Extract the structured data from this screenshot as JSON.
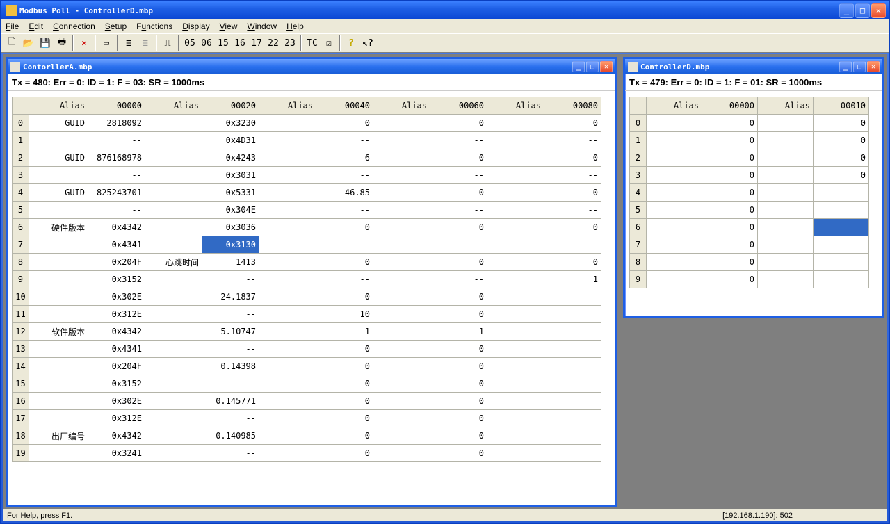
{
  "app": {
    "title": "Modbus Poll - ControllerD.mbp"
  },
  "menu": {
    "file": "File",
    "edit": "Edit",
    "connection": "Connection",
    "setup": "Setup",
    "functions": "Functions",
    "display": "Display",
    "view": "View",
    "window": "Window",
    "help": "Help"
  },
  "toolbar": {
    "codes": [
      "05",
      "06",
      "15",
      "16",
      "17",
      "22",
      "23"
    ],
    "tc": "TC"
  },
  "status": {
    "help": "For Help, press F1.",
    "addr": "[192.168.1.190]: 502"
  },
  "winA": {
    "title": "ContorllerA.mbp",
    "status": "Tx = 480: Err = 0: ID = 1: F = 03: SR = 1000ms",
    "headers": [
      "",
      "Alias",
      "00000",
      "Alias",
      "00020",
      "Alias",
      "00040",
      "Alias",
      "00060",
      "Alias",
      "00080"
    ],
    "selected": {
      "row": 7,
      "col": 4
    },
    "rows": [
      [
        "0",
        "GUID",
        "2818092",
        "",
        "0x3230",
        "",
        "0",
        "",
        "0",
        "",
        "0"
      ],
      [
        "1",
        "",
        "--",
        "",
        "0x4D31",
        "",
        "--",
        "",
        "--",
        "",
        "--"
      ],
      [
        "2",
        "GUID",
        "876168978",
        "",
        "0x4243",
        "",
        "-6",
        "",
        "0",
        "",
        "0"
      ],
      [
        "3",
        "",
        "--",
        "",
        "0x3031",
        "",
        "--",
        "",
        "--",
        "",
        "--"
      ],
      [
        "4",
        "GUID",
        "825243701",
        "",
        "0x5331",
        "",
        "-46.85",
        "",
        "0",
        "",
        "0"
      ],
      [
        "5",
        "",
        "--",
        "",
        "0x304E",
        "",
        "--",
        "",
        "--",
        "",
        "--"
      ],
      [
        "6",
        "硬件版本",
        "0x4342",
        "",
        "0x3036",
        "",
        "0",
        "",
        "0",
        "",
        "0"
      ],
      [
        "7",
        "",
        "0x4341",
        "",
        "0x3130",
        "",
        "--",
        "",
        "--",
        "",
        "--"
      ],
      [
        "8",
        "",
        "0x204F",
        "心跳时间",
        "1413",
        "",
        "0",
        "",
        "0",
        "",
        "0"
      ],
      [
        "9",
        "",
        "0x3152",
        "",
        "--",
        "",
        "--",
        "",
        "--",
        "",
        "1"
      ],
      [
        "10",
        "",
        "0x302E",
        "",
        "24.1837",
        "",
        "0",
        "",
        "0",
        "",
        ""
      ],
      [
        "11",
        "",
        "0x312E",
        "",
        "--",
        "",
        "10",
        "",
        "0",
        "",
        ""
      ],
      [
        "12",
        "软件版本",
        "0x4342",
        "",
        "5.10747",
        "",
        "1",
        "",
        "1",
        "",
        ""
      ],
      [
        "13",
        "",
        "0x4341",
        "",
        "--",
        "",
        "0",
        "",
        "0",
        "",
        ""
      ],
      [
        "14",
        "",
        "0x204F",
        "",
        "0.14398",
        "",
        "0",
        "",
        "0",
        "",
        ""
      ],
      [
        "15",
        "",
        "0x3152",
        "",
        "--",
        "",
        "0",
        "",
        "0",
        "",
        ""
      ],
      [
        "16",
        "",
        "0x302E",
        "",
        "0.145771",
        "",
        "0",
        "",
        "0",
        "",
        ""
      ],
      [
        "17",
        "",
        "0x312E",
        "",
        "--",
        "",
        "0",
        "",
        "0",
        "",
        ""
      ],
      [
        "18",
        "出厂编号",
        "0x4342",
        "",
        "0.140985",
        "",
        "0",
        "",
        "0",
        "",
        ""
      ],
      [
        "19",
        "",
        "0x3241",
        "",
        "--",
        "",
        "0",
        "",
        "0",
        "",
        ""
      ]
    ]
  },
  "winD": {
    "title": "ControllerD.mbp",
    "status": "Tx = 479: Err = 0: ID = 1: F = 01: SR = 1000ms",
    "headers": [
      "",
      "Alias",
      "00000",
      "Alias",
      "00010"
    ],
    "selected": {
      "row": 6,
      "col": 4
    },
    "rows": [
      [
        "0",
        "",
        "0",
        "",
        "0"
      ],
      [
        "1",
        "",
        "0",
        "",
        "0"
      ],
      [
        "2",
        "",
        "0",
        "",
        "0"
      ],
      [
        "3",
        "",
        "0",
        "",
        "0"
      ],
      [
        "4",
        "",
        "0",
        "",
        ""
      ],
      [
        "5",
        "",
        "0",
        "",
        ""
      ],
      [
        "6",
        "",
        "0",
        "",
        ""
      ],
      [
        "7",
        "",
        "0",
        "",
        ""
      ],
      [
        "8",
        "",
        "0",
        "",
        ""
      ],
      [
        "9",
        "",
        "0",
        "",
        ""
      ]
    ]
  }
}
